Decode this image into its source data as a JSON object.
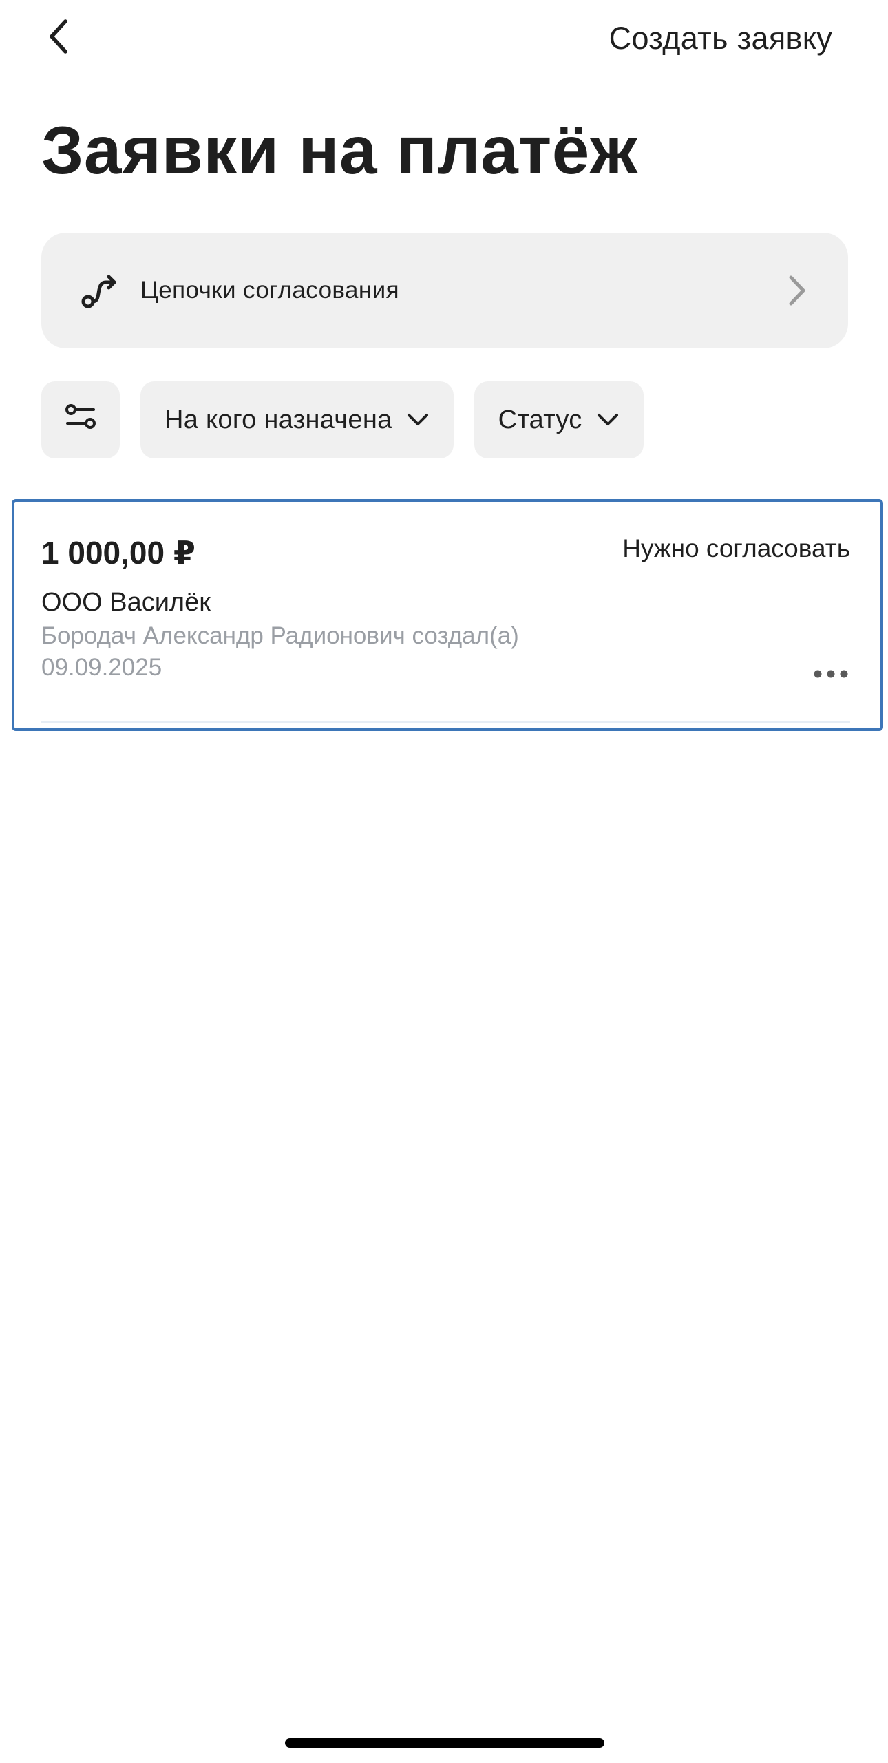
{
  "header": {
    "back_icon": "chevron-left-icon",
    "create_label": "Создать заявку"
  },
  "page": {
    "title": "Заявки на платёж"
  },
  "chains": {
    "icon": "route-icon",
    "label": "Цепочки согласования",
    "arrow_icon": "chevron-right-icon"
  },
  "filters": {
    "settings_icon": "sliders-icon",
    "assignee_label": "На кого назначена",
    "status_label": "Статус",
    "dropdown_icon": "chevron-down-icon"
  },
  "requests": [
    {
      "amount": "1 000,00 ₽",
      "status": "Нужно согласовать",
      "company": "ООО Василёк",
      "creator": "Бородач Александр Радионович создал(а)",
      "date": "09.09.2025",
      "more_icon": "more-horizontal-icon"
    }
  ],
  "colors": {
    "text": "#1f1f1f",
    "muted_text": "#9a9ea4",
    "chip_background": "#f0f0f0",
    "selected_border": "#3d76b8"
  }
}
